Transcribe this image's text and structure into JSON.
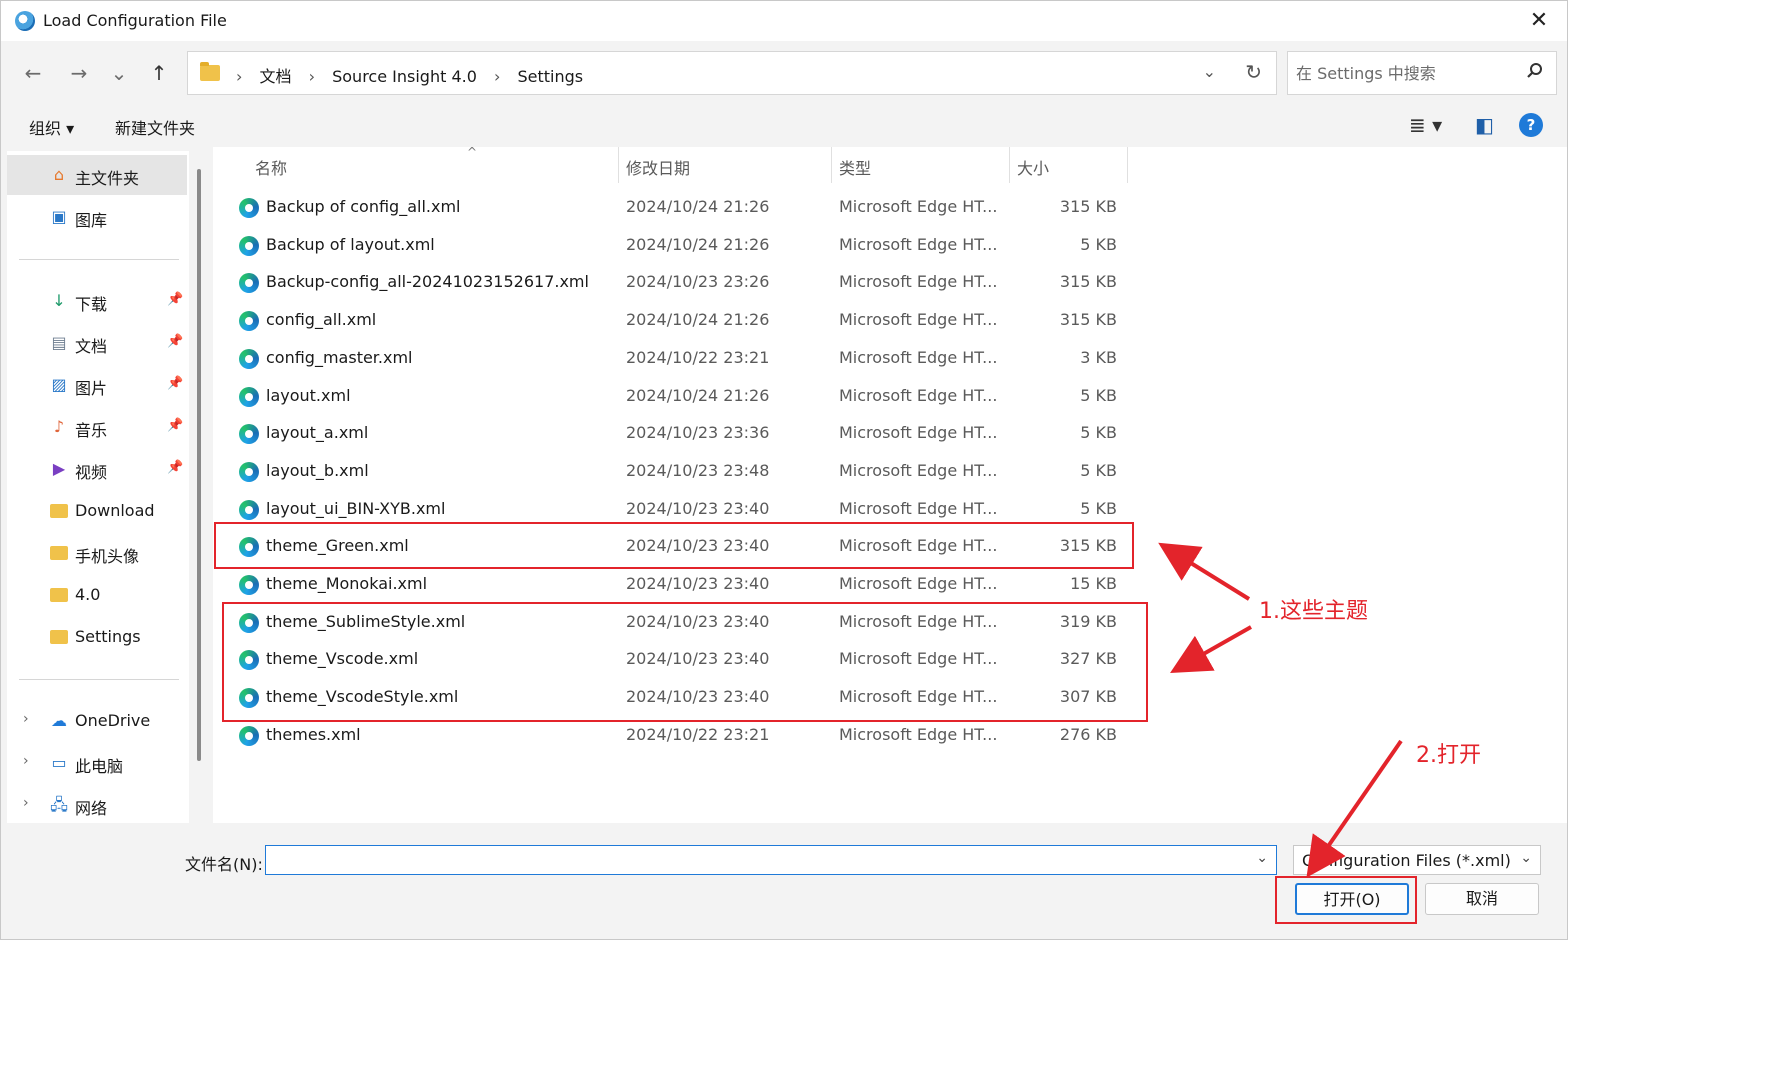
{
  "window": {
    "title": "Load Configuration File",
    "close_glyph": "✕"
  },
  "nav": {
    "back": "←",
    "forward": "→",
    "recent": "⌄",
    "up": "↑",
    "breadcrumbs": [
      "文档",
      "Source Insight 4.0",
      "Settings"
    ],
    "crumb_sep": "›",
    "dropdown": "⌄",
    "refresh": "↻"
  },
  "search": {
    "placeholder": "在 Settings 中搜索",
    "icon": "search-icon"
  },
  "toolbar": {
    "organize": "组织 ▾",
    "new_folder": "新建文件夹",
    "view_icon": "≣ ▾",
    "pane_icon": "◧",
    "help": "?"
  },
  "sidebar": {
    "items": [
      {
        "label": "主文件夹",
        "icon": "⌂",
        "pin": ""
      },
      {
        "label": "图库",
        "icon": "▣",
        "pin": ""
      },
      {
        "label": "下载",
        "icon": "↓",
        "pin": "📌"
      },
      {
        "label": "文档",
        "icon": "▤",
        "pin": "📌"
      },
      {
        "label": "图片",
        "icon": "▨",
        "pin": "📌"
      },
      {
        "label": "音乐",
        "icon": "♪",
        "pin": "📌"
      },
      {
        "label": "视频",
        "icon": "▶",
        "pin": "📌"
      },
      {
        "label": "Download",
        "icon": "",
        "pin": ""
      },
      {
        "label": "手机头像",
        "icon": "",
        "pin": ""
      },
      {
        "label": "4.0",
        "icon": "",
        "pin": ""
      },
      {
        "label": "Settings",
        "icon": "",
        "pin": ""
      },
      {
        "label": "OneDrive",
        "icon": "☁",
        "expand": "›"
      },
      {
        "label": "此电脑",
        "icon": "▭",
        "expand": "›"
      },
      {
        "label": "网络",
        "icon": "🖧",
        "expand": "›"
      }
    ]
  },
  "columns": {
    "name": "名称",
    "date": "修改日期",
    "type": "类型",
    "size": "大小",
    "sort_caret": "^"
  },
  "files": [
    {
      "name": "Backup of config_all.xml",
      "date": "2024/10/24 21:26",
      "type": "Microsoft Edge HT...",
      "size": "315 KB"
    },
    {
      "name": "Backup of layout.xml",
      "date": "2024/10/24 21:26",
      "type": "Microsoft Edge HT...",
      "size": "5 KB"
    },
    {
      "name": "Backup-config_all-20241023152617.xml",
      "date": "2024/10/23 23:26",
      "type": "Microsoft Edge HT...",
      "size": "315 KB"
    },
    {
      "name": "config_all.xml",
      "date": "2024/10/24 21:26",
      "type": "Microsoft Edge HT...",
      "size": "315 KB"
    },
    {
      "name": "config_master.xml",
      "date": "2024/10/22 23:21",
      "type": "Microsoft Edge HT...",
      "size": "3 KB"
    },
    {
      "name": "layout.xml",
      "date": "2024/10/24 21:26",
      "type": "Microsoft Edge HT...",
      "size": "5 KB"
    },
    {
      "name": "layout_a.xml",
      "date": "2024/10/23 23:36",
      "type": "Microsoft Edge HT...",
      "size": "5 KB"
    },
    {
      "name": "layout_b.xml",
      "date": "2024/10/23 23:48",
      "type": "Microsoft Edge HT...",
      "size": "5 KB"
    },
    {
      "name": "layout_ui_BIN-XYB.xml",
      "date": "2024/10/23 23:40",
      "type": "Microsoft Edge HT...",
      "size": "5 KB"
    },
    {
      "name": "theme_Green.xml",
      "date": "2024/10/23 23:40",
      "type": "Microsoft Edge HT...",
      "size": "315 KB"
    },
    {
      "name": "theme_Monokai.xml",
      "date": "2024/10/23 23:40",
      "type": "Microsoft Edge HT...",
      "size": "15 KB"
    },
    {
      "name": "theme_SublimeStyle.xml",
      "date": "2024/10/23 23:40",
      "type": "Microsoft Edge HT...",
      "size": "319 KB"
    },
    {
      "name": "theme_Vscode.xml",
      "date": "2024/10/23 23:40",
      "type": "Microsoft Edge HT...",
      "size": "327 KB"
    },
    {
      "name": "theme_VscodeStyle.xml",
      "date": "2024/10/23 23:40",
      "type": "Microsoft Edge HT...",
      "size": "307 KB"
    },
    {
      "name": "themes.xml",
      "date": "2024/10/22 23:21",
      "type": "Microsoft Edge HT...",
      "size": "276 KB"
    }
  ],
  "annotations": {
    "themes_note": "1.这些主题",
    "open_note": "2.打开",
    "color": "#e3242b"
  },
  "footer": {
    "filename_label": "文件名(N):",
    "filename_value": "",
    "filetype": "Configuration Files (*.xml)",
    "dropdown": "⌄",
    "open": "打开(O)",
    "cancel": "取消"
  }
}
